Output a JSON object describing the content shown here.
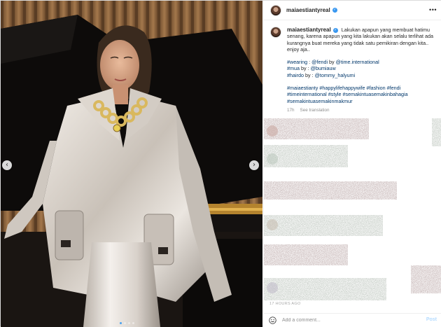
{
  "post": {
    "username": "maiaestiantyreal",
    "verified_icon": "verified-badge-icon",
    "more_icon": "more-options-icon",
    "caption": {
      "line1": "Lakukan apapun yang membuat hatimu senang, karena apapun yang kita lakukan akan selalu terlihat ada kurangnya buat mereka yang tidak satu pemikiran dengan kita.. enjoy aja..",
      "credits": [
        {
          "tag": "#wearing",
          "by": " : ",
          "handle": "@fendi",
          "by2": " by ",
          "handle2": "@time.international"
        },
        {
          "tag": "#mua",
          "by": " by : ",
          "handle": "@bumiauw"
        },
        {
          "tag": "#hairdo",
          "by": " by : ",
          "handle": "@tommy_halyumi"
        }
      ],
      "hashtags": "#maiaestianty #happylifehappywife #fashion #fendi #timeinternational #style #semakintuasemakinbahagia #semakintuasemakinmakmur"
    },
    "age": "17h",
    "see_translation": "See translation",
    "time_ago": "17 HOURS AGO"
  },
  "comment_box": {
    "emoji_icon": "emoji-icon",
    "placeholder": "Add a comment...",
    "post_label": "Post"
  },
  "carousel": {
    "prev_icon": "chevron-left-icon",
    "next_icon": "chevron-right-icon",
    "prev_glyph": "‹",
    "next_glyph": "›",
    "slide_count": 4,
    "active_index": 0
  },
  "colors": {
    "link": "#00376b",
    "verified": "#3897f0",
    "post_disabled": "#b3dbff",
    "muted": "#8e8e8e"
  }
}
